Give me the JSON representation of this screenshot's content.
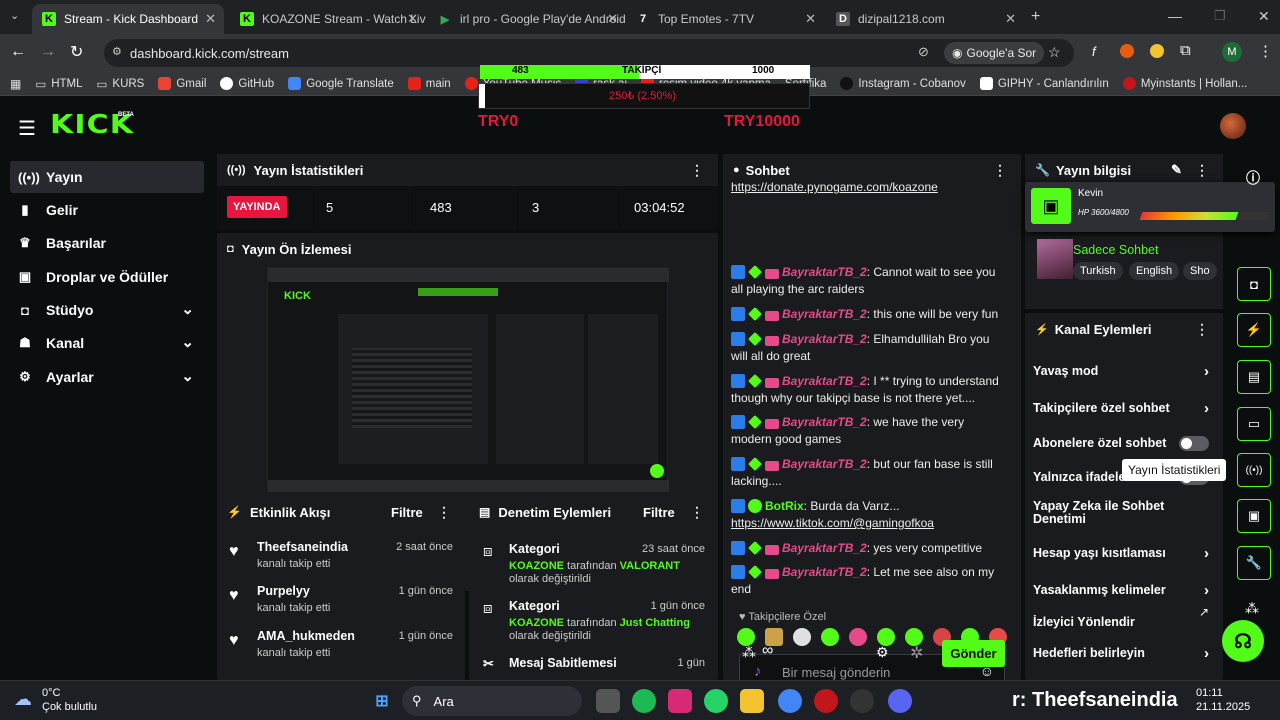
{
  "browser": {
    "tabs": [
      {
        "title": "Stream - Kick Dashboard",
        "active": true
      },
      {
        "title": "KOAZONE Stream - Watch Live"
      },
      {
        "title": "irl pro - Google Play'de Android"
      },
      {
        "title": "Top Emotes - 7TV"
      },
      {
        "title": "dizipal1218.com"
      }
    ],
    "url": "dashboard.kick.com/stream",
    "google_lens_label": "Google'a Sor",
    "profile_initial": "M",
    "bookmarks": [
      "HTML",
      "KURS",
      "Gmail",
      "GitHub",
      "Google Translate",
      "main",
      "YouTube Music",
      "rask.ai",
      "resim video 4k yapma",
      "Sertifika",
      "Instagram - Cobanov",
      "GIPHY - Canlandırılın",
      "Myinstants | Hollan..."
    ]
  },
  "overlay": {
    "left_value": "483",
    "center_label": "TAKİPÇİ",
    "right_value": "1000",
    "progress": 0.483,
    "amount": "250₺ (2.50%)",
    "min_label": "TRY0",
    "max_label": "TRY10000"
  },
  "nav": {
    "items": [
      {
        "label": "Yayın",
        "icon": "broadcast-icon",
        "active": true
      },
      {
        "label": "Gelir",
        "icon": "revenue-icon"
      },
      {
        "label": "Başarılar",
        "icon": "trophy-icon"
      },
      {
        "label": "Droplar ve Ödüller",
        "icon": "gift-icon"
      },
      {
        "label": "Stüdyo",
        "icon": "studio-icon",
        "expandable": true
      },
      {
        "label": "Kanal",
        "icon": "channel-icon",
        "expandable": true
      },
      {
        "label": "Ayarlar",
        "icon": "gear-icon",
        "expandable": true
      }
    ]
  },
  "stats": {
    "title": "Yayın İstatistikleri",
    "live_badge": "YAYINDA",
    "viewers": "5",
    "followers": "483",
    "subs": "3",
    "uptime": "03:04:52"
  },
  "preview": {
    "title": "Yayın Ön İzlemesi"
  },
  "activity": {
    "title": "Etkinlik Akışı",
    "filter_label": "Filtre",
    "events": [
      {
        "name": "Theefsaneindia",
        "desc": "kanalı takip etti",
        "time": "2 saat önce"
      },
      {
        "name": "Purpelyy",
        "desc": "kanalı takip etti",
        "time": "1 gün önce"
      },
      {
        "name": "AMA_hukmeden",
        "desc": "kanalı takip etti",
        "time": "1 gün önce"
      }
    ]
  },
  "moderation": {
    "title": "Denetim Eylemleri",
    "filter_label": "Filtre",
    "items": [
      {
        "title": "Kategori",
        "time": "23 saat önce",
        "channel": "KOAZONE",
        "middle": " tarafından ",
        "target": "VALORANT",
        "suffix": " olarak değiştirildi"
      },
      {
        "title": "Kategori",
        "time": "1 gün önce",
        "channel": "KOAZONE",
        "middle": " tarafından ",
        "target": "Just Chatting",
        "suffix": " olarak değiştirildi"
      },
      {
        "title": "Mesaj Sabitlemesi",
        "time": "1 gün"
      }
    ]
  },
  "chat": {
    "title": "Sohbet",
    "top_link": "https://donate.pynogame.com/koazone",
    "messages": [
      {
        "user": "BayraktarTB_2",
        "text": "Cannot wait to see you all playing the arc raiders"
      },
      {
        "user": "BayraktarTB_2",
        "text": "this one will be very fun"
      },
      {
        "user": "BayraktarTB_2",
        "text": "Elhamdullilah Bro you will all do great"
      },
      {
        "user": "BayraktarTB_2",
        "text": "I ** trying to understand though why our takipçi base is not there yet...."
      },
      {
        "user": "BayraktarTB_2",
        "text": "we have the very modern good games"
      },
      {
        "user": "BayraktarTB_2",
        "text": "but our fan base is still lacking...."
      },
      {
        "user": "BotRix",
        "text": "Burda da Varız...",
        "link": "https://www.tiktok.com/@gamingofkoa",
        "bot": true
      },
      {
        "user": "BayraktarTB_2",
        "text": "yes very competitive"
      },
      {
        "user": "BayraktarTB_2",
        "text": "Let me see also on my end"
      }
    ],
    "followers_only": "Takipçilere Özel",
    "input_placeholder": "Bir mesaj gönderin",
    "send_label": "Gönder"
  },
  "stream_info": {
    "title": "Yayın bilgisi",
    "viewer_name": "Kevin",
    "hp_text": "HP 3600/4800",
    "hp_fraction": 0.75,
    "category": "Sadece Sohbet",
    "tags": [
      "Turkish",
      "English",
      "Sho"
    ]
  },
  "channel_actions": {
    "title": "Kanal Eylemleri",
    "items": [
      {
        "label": "Yavaş mod",
        "type": "chevron"
      },
      {
        "label": "Takipçilere özel sohbet",
        "type": "chevron"
      },
      {
        "label": "Abonelere özel sohbet",
        "type": "toggle"
      },
      {
        "label": "Yalnızca ifadeler",
        "type": "toggle"
      },
      {
        "label": "Yapay Zeka ile Sohbet Denetimi",
        "type": "external"
      },
      {
        "label": "Hesap yaşı kısıtlaması",
        "type": "chevron"
      },
      {
        "label": "Yasaklanmış kelimeler",
        "type": "chevron"
      },
      {
        "label": "İzleyici Yönlendir",
        "type": "none"
      },
      {
        "label": "Hedefleri belirleyin",
        "type": "chevron"
      }
    ],
    "tooltip": "Yayın İstatistikleri"
  },
  "taskbar": {
    "weather_temp": "0°C",
    "weather_desc": "Çok bulutlu",
    "search_label": "Ara",
    "ticker": "r: Theefsaneindia",
    "time": "01:11",
    "date": "21.11.2025"
  },
  "colors": {
    "kick_green": "#53fc18",
    "live_red": "#e5173f",
    "panel": "#191b1f",
    "user_pink": "#e64a8a"
  }
}
